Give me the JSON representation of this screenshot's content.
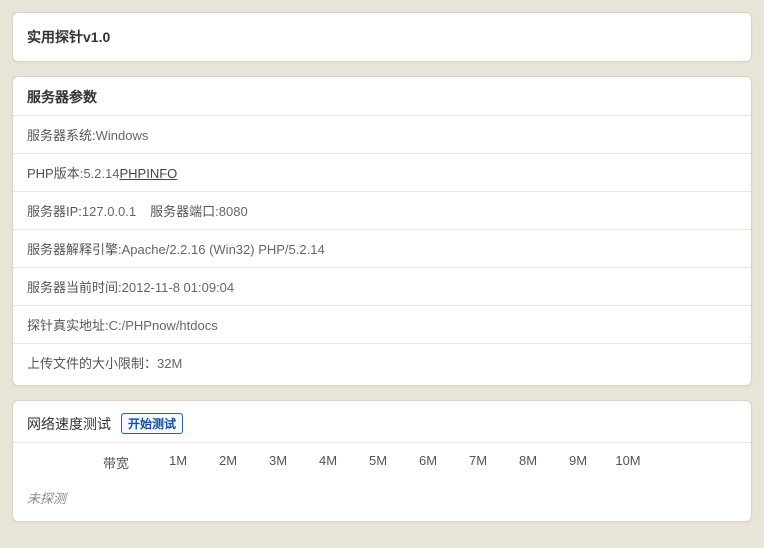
{
  "header": {
    "title": "实用探针v1.0"
  },
  "server_params": {
    "section_title": "服务器参数",
    "os_label": "服务器系统:",
    "os_value": "Windows",
    "php_version_label": "PHP版本:",
    "php_version_value": "5.2.14",
    "phpinfo_link": "PHPINFO",
    "ip_label": "服务器IP:",
    "ip_value": "127.0.0.1",
    "port_label": "服务器端口:",
    "port_value": "8080",
    "engine_label": "服务器解释引擎:",
    "engine_value": "Apache/2.2.16 (Win32) PHP/5.2.14",
    "time_label": "服务器当前时间:",
    "time_value": "2012-11-8 01:09:04",
    "probe_path_label": "探针真实地址:",
    "probe_path_value": "C:/PHPnow/htdocs",
    "upload_limit_label": "上传文件的大小限制：",
    "upload_limit_value": "32M"
  },
  "speed_test": {
    "section_title": "网络速度测试",
    "start_button": "开始测试",
    "bandwidth_label": "带宽",
    "ticks": [
      "1M",
      "2M",
      "3M",
      "4M",
      "5M",
      "6M",
      "7M",
      "8M",
      "9M",
      "10M"
    ],
    "not_measured": "未探测"
  }
}
